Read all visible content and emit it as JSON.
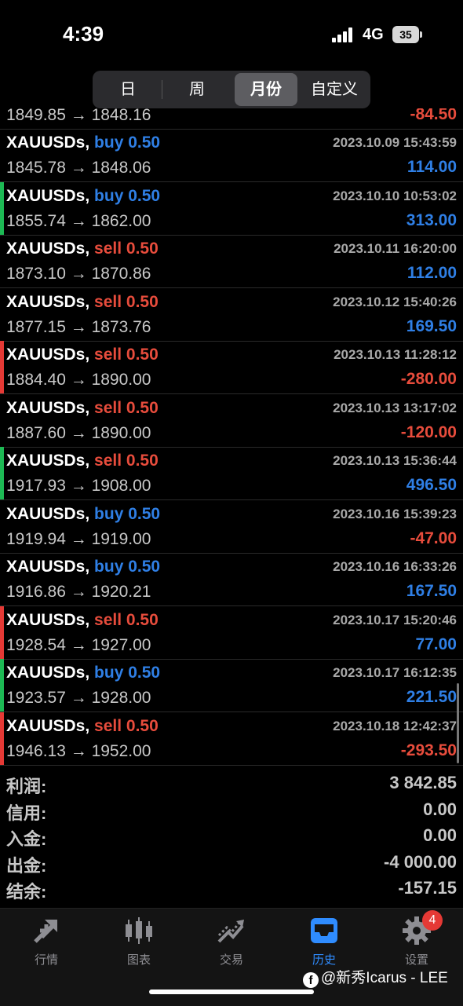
{
  "status": {
    "time": "4:39",
    "network": "4G",
    "battery": "35"
  },
  "segments": [
    "日",
    "周",
    "月份",
    "自定义"
  ],
  "active_segment": "月份",
  "partial_row": {
    "prices": "1849.85 → 1848.16",
    "pnl": "-84.50"
  },
  "trades": [
    {
      "symbol": "XAUUSDs,",
      "side": "buy",
      "volume": "0.50",
      "datetime": "2023.10.09 15:43:59",
      "prices": "1845.78 → 1848.06",
      "pnl": "114.00",
      "marker": ""
    },
    {
      "symbol": "XAUUSDs,",
      "side": "buy",
      "volume": "0.50",
      "datetime": "2023.10.10 10:53:02",
      "prices": "1855.74 → 1862.00",
      "pnl": "313.00",
      "marker": "#1db954"
    },
    {
      "symbol": "XAUUSDs,",
      "side": "sell",
      "volume": "0.50",
      "datetime": "2023.10.11 16:20:00",
      "prices": "1873.10 → 1870.86",
      "pnl": "112.00",
      "marker": ""
    },
    {
      "symbol": "XAUUSDs,",
      "side": "sell",
      "volume": "0.50",
      "datetime": "2023.10.12 15:40:26",
      "prices": "1877.15 → 1873.76",
      "pnl": "169.50",
      "marker": ""
    },
    {
      "symbol": "XAUUSDs,",
      "side": "sell",
      "volume": "0.50",
      "datetime": "2023.10.13 11:28:12",
      "prices": "1884.40 → 1890.00",
      "pnl": "-280.00",
      "marker": "#e53935"
    },
    {
      "symbol": "XAUUSDs,",
      "side": "sell",
      "volume": "0.50",
      "datetime": "2023.10.13 13:17:02",
      "prices": "1887.60 → 1890.00",
      "pnl": "-120.00",
      "marker": ""
    },
    {
      "symbol": "XAUUSDs,",
      "side": "sell",
      "volume": "0.50",
      "datetime": "2023.10.13 15:36:44",
      "prices": "1917.93 → 1908.00",
      "pnl": "496.50",
      "marker": "#1db954"
    },
    {
      "symbol": "XAUUSDs,",
      "side": "buy",
      "volume": "0.50",
      "datetime": "2023.10.16 15:39:23",
      "prices": "1919.94 → 1919.00",
      "pnl": "-47.00",
      "marker": ""
    },
    {
      "symbol": "XAUUSDs,",
      "side": "buy",
      "volume": "0.50",
      "datetime": "2023.10.16 16:33:26",
      "prices": "1916.86 → 1920.21",
      "pnl": "167.50",
      "marker": ""
    },
    {
      "symbol": "XAUUSDs,",
      "side": "sell",
      "volume": "0.50",
      "datetime": "2023.10.17 15:20:46",
      "prices": "1928.54 → 1927.00",
      "pnl": "77.00",
      "marker": "#e53935"
    },
    {
      "symbol": "XAUUSDs,",
      "side": "buy",
      "volume": "0.50",
      "datetime": "2023.10.17 16:12:35",
      "prices": "1923.57 → 1928.00",
      "pnl": "221.50",
      "marker": "#1db954"
    },
    {
      "symbol": "XAUUSDs,",
      "side": "sell",
      "volume": "0.50",
      "datetime": "2023.10.18 12:42:37",
      "prices": "1946.13 → 1952.00",
      "pnl": "-293.50",
      "marker": "#e53935"
    }
  ],
  "summary": [
    {
      "label": "利润:",
      "value": "3 842.85"
    },
    {
      "label": "信用:",
      "value": "0.00"
    },
    {
      "label": "入金:",
      "value": "0.00"
    },
    {
      "label": "出金:",
      "value": "-4 000.00"
    },
    {
      "label": "结余:",
      "value": "-157.15"
    }
  ],
  "nav": [
    {
      "label": "行情",
      "icon": "quotes-icon"
    },
    {
      "label": "图表",
      "icon": "chart-candles-icon"
    },
    {
      "label": "交易",
      "icon": "trade-icon"
    },
    {
      "label": "历史",
      "icon": "history-inbox-icon"
    },
    {
      "label": "设置",
      "icon": "gear-icon",
      "badge": "4"
    }
  ],
  "active_nav": "历史",
  "watermark": "@新秀Icarus - LEE",
  "colors": {
    "buy": "#2f7fe5",
    "sell": "#e74c3c",
    "active_nav": "#2f8cff"
  }
}
